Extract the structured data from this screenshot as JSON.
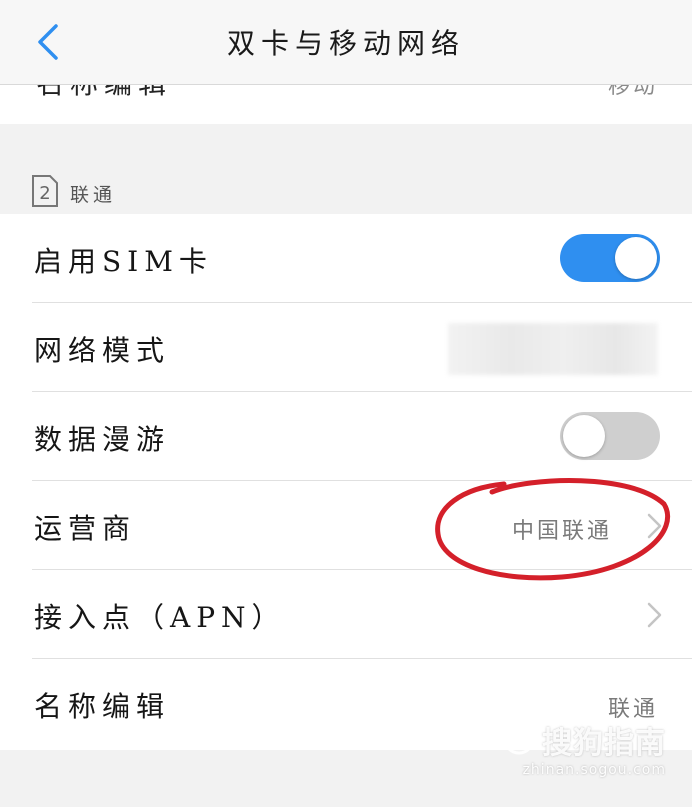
{
  "header": {
    "title": "双卡与移动网络",
    "back_icon": "chevron-left-icon"
  },
  "partial_row": {
    "label": "名称编辑",
    "value": "移动"
  },
  "section": {
    "sim_slot": "2",
    "carrier": "联通"
  },
  "rows": [
    {
      "label": "启用SIM卡",
      "type": "toggle",
      "checked": true
    },
    {
      "label": "网络模式",
      "type": "value",
      "value": ""
    },
    {
      "label": "数据漫游",
      "type": "toggle",
      "checked": false
    },
    {
      "label": "运营商",
      "type": "link",
      "value": "中国联通"
    },
    {
      "label": "接入点（APN）",
      "type": "link",
      "value": ""
    },
    {
      "label": "名称编辑",
      "type": "value",
      "value": "联通"
    }
  ],
  "colors": {
    "accent": "#2f8ff0",
    "annotation": "#d4202a"
  },
  "watermark": {
    "brand": "搜狗指南",
    "url": "zhinan.sogou.com"
  }
}
